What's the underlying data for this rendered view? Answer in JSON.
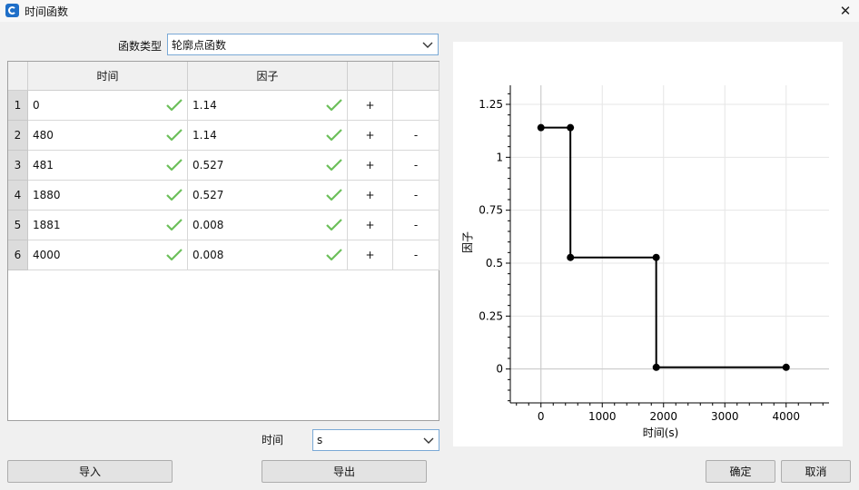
{
  "window": {
    "title": "时间函数",
    "close_glyph": "✕"
  },
  "function_type": {
    "label": "函数类型",
    "value": "轮廓点函数"
  },
  "table": {
    "columns": [
      "时间",
      "因子",
      "",
      ""
    ],
    "rows": [
      {
        "index": "1",
        "time": "0",
        "factor": "1.14",
        "add": "+",
        "remove": ""
      },
      {
        "index": "2",
        "time": "480",
        "factor": "1.14",
        "add": "+",
        "remove": "-"
      },
      {
        "index": "3",
        "time": "481",
        "factor": "0.527",
        "add": "+",
        "remove": "-"
      },
      {
        "index": "4",
        "time": "1880",
        "factor": "0.527",
        "add": "+",
        "remove": "-"
      },
      {
        "index": "5",
        "time": "1881",
        "factor": "0.008",
        "add": "+",
        "remove": "-"
      },
      {
        "index": "6",
        "time": "4000",
        "factor": "0.008",
        "add": "+",
        "remove": "-"
      }
    ]
  },
  "time_unit": {
    "label": "时间",
    "value": "s"
  },
  "buttons": {
    "import": "导入",
    "export": "导出",
    "ok": "确定",
    "cancel": "取消"
  },
  "colors": {
    "check": "#6cbf5a",
    "line": "#000000",
    "grid": "#e6e6e6",
    "combo_border": "#7aa9d6"
  },
  "chart_data": {
    "type": "line",
    "x": [
      0,
      480,
      481,
      1880,
      1881,
      4000
    ],
    "y": [
      1.14,
      1.14,
      0.527,
      0.527,
      0.008,
      0.008
    ],
    "xlabel": "时间(s)",
    "ylabel": "因子",
    "xlim": [
      -500,
      4700
    ],
    "ylim": [
      -0.16,
      1.34
    ],
    "xticks": [
      0,
      1000,
      2000,
      3000,
      4000
    ],
    "yticks": [
      0,
      0.25,
      0.5,
      0.75,
      1,
      1.25
    ],
    "ytick_labels": [
      "0",
      "0.25",
      "0.5",
      "0.75",
      "1",
      "1.25"
    ],
    "grid": true,
    "markers": true
  }
}
